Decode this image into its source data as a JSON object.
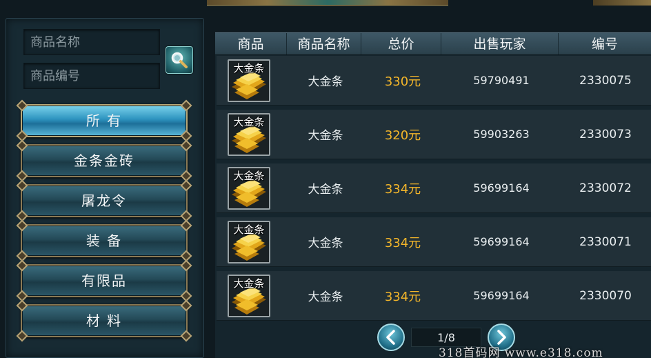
{
  "search": {
    "name_placeholder": "商品名称",
    "code_placeholder": "商品编号"
  },
  "categories": [
    {
      "label": "所 有",
      "active": true
    },
    {
      "label": "金条金砖",
      "active": false
    },
    {
      "label": "屠龙令",
      "active": false
    },
    {
      "label": "装 备",
      "active": false
    },
    {
      "label": "有限品",
      "active": false
    },
    {
      "label": "材 料",
      "active": false
    }
  ],
  "table": {
    "headers": [
      "商品",
      "商品名称",
      "总价",
      "出售玩家",
      "编号"
    ],
    "rows": [
      {
        "icon_label": "大金条",
        "name": "大金条",
        "price": "330元",
        "seller": "59790491",
        "id": "2330075"
      },
      {
        "icon_label": "大金条",
        "name": "大金条",
        "price": "320元",
        "seller": "59903263",
        "id": "2330073"
      },
      {
        "icon_label": "大金条",
        "name": "大金条",
        "price": "334元",
        "seller": "59699164",
        "id": "2330072"
      },
      {
        "icon_label": "大金条",
        "name": "大金条",
        "price": "334元",
        "seller": "59699164",
        "id": "2330071"
      },
      {
        "icon_label": "大金条",
        "name": "大金条",
        "price": "334元",
        "seller": "59699164",
        "id": "2330070"
      }
    ]
  },
  "pager": {
    "page": "1/8"
  },
  "watermark": "318首码网 www.e318.com",
  "colors": {
    "price": "#f4b62a",
    "active_tab": "#2d93bf"
  },
  "icons": {
    "search": "magnifier-icon",
    "prev": "chevron-left-icon",
    "next": "chevron-right-icon",
    "item": "gold-bar-icon"
  }
}
